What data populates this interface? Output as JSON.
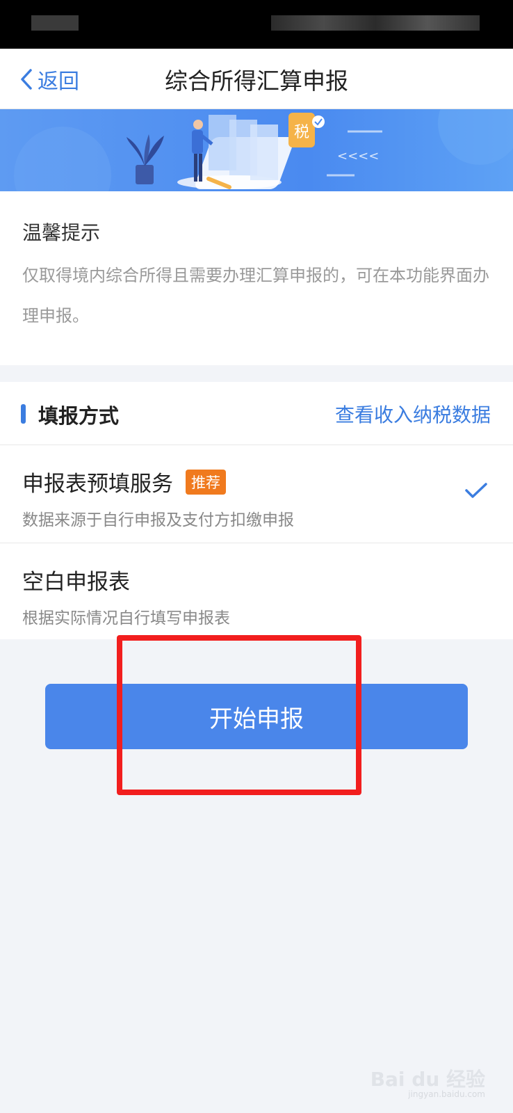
{
  "nav": {
    "back_label": "返回",
    "title": "综合所得汇算申报"
  },
  "banner": {
    "badge": "税",
    "arrows": "<<<<"
  },
  "tips": {
    "title": "温馨提示",
    "text": "仅取得境内综合所得且需要办理汇算申报的，可在本功能界面办理申报。"
  },
  "section": {
    "title": "填报方式",
    "link": "查看收入纳税数据",
    "options": [
      {
        "title": "申报表预填服务",
        "badge": "推荐",
        "subtitle": "数据来源于自行申报及支付方扣缴申报",
        "selected": true
      },
      {
        "title": "空白申报表",
        "subtitle": "根据实际情况自行填写申报表",
        "selected": false
      }
    ]
  },
  "start_button": {
    "label": "开始申报"
  },
  "watermark": {
    "brand": "Bai du 经验",
    "url": "jingyan.baidu.com"
  },
  "colors": {
    "accent": "#3b7de0",
    "button": "#4a86ea",
    "badge": "#f07a1e",
    "annotation": "#f21e1e"
  }
}
